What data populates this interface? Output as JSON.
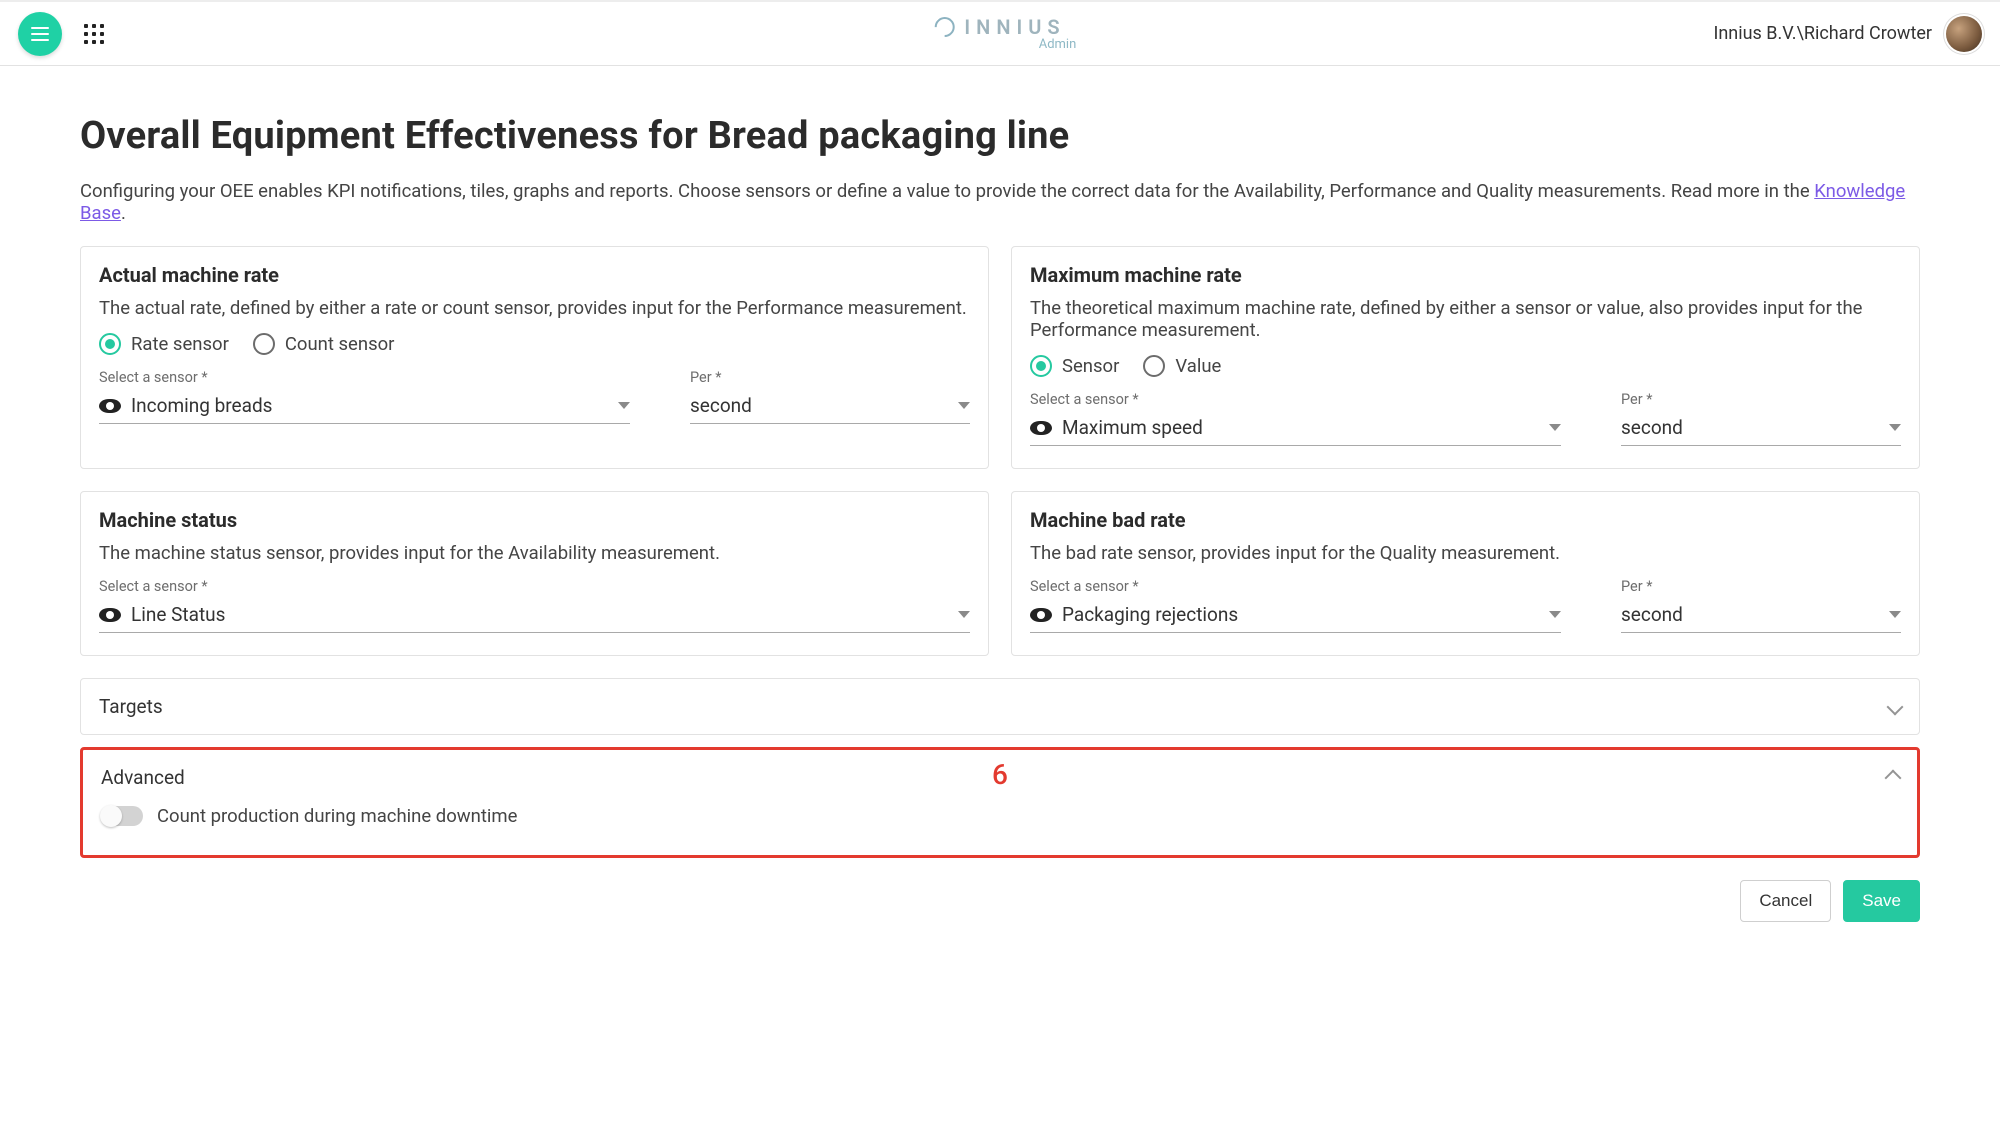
{
  "header": {
    "brand_text": "INNIUS",
    "brand_sub": "Admin",
    "user_text": "Innius B.V.\\Richard Crowter"
  },
  "page": {
    "title": "Overall Equipment Effectiveness for Bread packaging line",
    "intro_pre": "Configuring your OEE enables KPI notifications, tiles, graphs and reports. Choose sensors or define a value to provide the correct data for the Availability, Performance and Quality measurements. Read more in the ",
    "intro_link": "Knowledge Base",
    "intro_post": "."
  },
  "labels": {
    "select_sensor": "Select a sensor *",
    "per": "Per *"
  },
  "cards": {
    "actual": {
      "title": "Actual machine rate",
      "desc": "The actual rate, defined by either a rate or count sensor, provides input for the Performance measurement.",
      "radio_rate": "Rate sensor",
      "radio_count": "Count sensor",
      "sensor_value": "Incoming breads",
      "per_value": "second"
    },
    "max": {
      "title": "Maximum machine rate",
      "desc": "The theoretical maximum machine rate, defined by either a sensor or value, also provides input for the Performance measurement.",
      "radio_sensor": "Sensor",
      "radio_value": "Value",
      "sensor_value": "Maximum speed",
      "per_value": "second"
    },
    "status": {
      "title": "Machine status",
      "desc": "The machine status sensor, provides input for the Availability measurement.",
      "sensor_value": "Line Status"
    },
    "bad": {
      "title": "Machine bad rate",
      "desc": "The bad rate sensor, provides input for the Quality measurement.",
      "sensor_value": "Packaging rejections",
      "per_value": "second"
    }
  },
  "accordion": {
    "targets_title": "Targets",
    "advanced_title": "Advanced",
    "advanced_toggle_label": "Count production during machine downtime",
    "advanced_toggle_on": false,
    "annotation": "6"
  },
  "buttons": {
    "cancel": "Cancel",
    "save": "Save"
  }
}
